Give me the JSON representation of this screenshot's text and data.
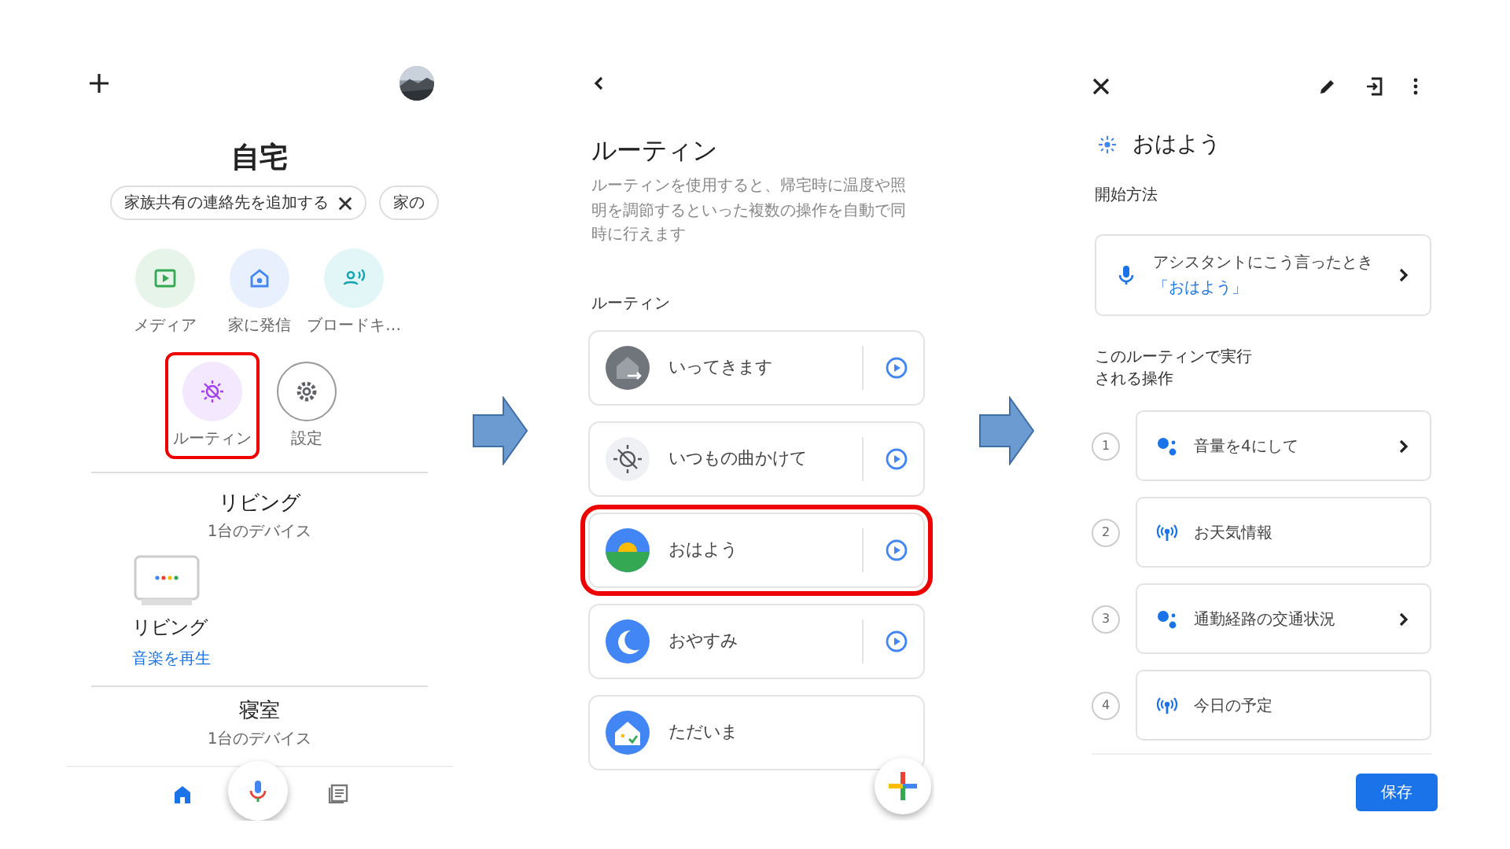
{
  "home": {
    "title": "自宅",
    "chips": [
      {
        "label": "家族共有の連絡先を追加する",
        "dismissible": true
      },
      {
        "label": "家の",
        "dismissible": false
      }
    ],
    "shortcuts": [
      {
        "kind": "media",
        "label": "メディア",
        "highlighted": false
      },
      {
        "kind": "call",
        "label": "家に発信",
        "highlighted": false
      },
      {
        "kind": "broadcast",
        "label": "ブロードキ…",
        "highlighted": false
      },
      {
        "kind": "routine",
        "label": "ルーティン",
        "highlighted": true
      },
      {
        "kind": "settings",
        "label": "設定",
        "highlighted": false
      }
    ],
    "rooms": [
      {
        "name": "リビング",
        "subtitle": "1台のデバイス",
        "device": {
          "name": "リビング",
          "action": "音楽を再生"
        }
      },
      {
        "name": "寝室",
        "subtitle": "1台のデバイス"
      }
    ],
    "nav": [
      {
        "kind": "home",
        "selected": true
      },
      {
        "kind": "library",
        "selected": false
      }
    ]
  },
  "routines": {
    "title": "ルーティン",
    "description": "ルーティンを使用すると、帰宅時に温度や照明を調節するといった複数の操作を自動で同時に行えます",
    "section": "ルーティン",
    "items": [
      {
        "kind": "away",
        "label": "いってきます",
        "highlighted": false,
        "play": true
      },
      {
        "kind": "music",
        "label": "いつもの曲かけて",
        "highlighted": false,
        "play": true
      },
      {
        "kind": "morning",
        "label": "おはよう",
        "highlighted": true,
        "play": true
      },
      {
        "kind": "night",
        "label": "おやすみ",
        "highlighted": false,
        "play": true
      },
      {
        "kind": "home",
        "label": "ただいま",
        "highlighted": false,
        "play": false
      }
    ]
  },
  "detail": {
    "title": "おはよう",
    "start_heading": "開始方法",
    "starter": {
      "label": "アシスタントにこう言ったとき",
      "phrase": "「おはよう」"
    },
    "actions_heading": "このルーティンで実行される操作",
    "actions": [
      {
        "number": "1",
        "kind": "assistant",
        "label": "音量を4にして",
        "chevron": true
      },
      {
        "number": "2",
        "kind": "broadcast",
        "label": "お天気情報",
        "chevron": false
      },
      {
        "number": "3",
        "kind": "assistant",
        "label": "通勤経路の交通状況",
        "chevron": true
      },
      {
        "number": "4",
        "kind": "broadcast",
        "label": "今日の予定",
        "chevron": false
      }
    ],
    "save_button": "保存"
  }
}
